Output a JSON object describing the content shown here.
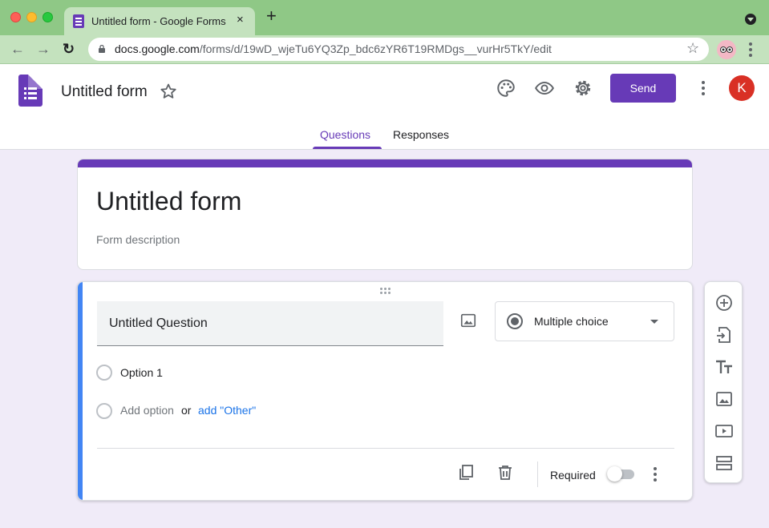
{
  "browser": {
    "tab_title": "Untitled form - Google Forms",
    "tab_close": "×",
    "new_tab": "+",
    "url_host": "docs.google.com",
    "url_path": "/forms/d/19wD_wjeTu6YQ3Zp_bdc6zYR6T19RMDgs__vurHr5TkY/edit",
    "back": "←",
    "forward": "→",
    "reload": "↻",
    "bookmark": "☆"
  },
  "header": {
    "doc_title": "Untitled form",
    "send_label": "Send",
    "avatar_letter": "K",
    "accent": "#673ab7"
  },
  "tabs": [
    {
      "label": "Questions",
      "active": true
    },
    {
      "label": "Responses",
      "active": false
    }
  ],
  "form": {
    "title": "Untitled form",
    "description": "Form description"
  },
  "question": {
    "text": "Untitled Question",
    "type": "Multiple choice",
    "options": [
      "Option 1"
    ],
    "add_option": "Add option",
    "or": "or",
    "add_other": "add \"Other\"",
    "required_label": "Required",
    "required": false
  },
  "side_toolbar": [
    "add-question-icon",
    "import-questions-icon",
    "add-title-icon",
    "add-image-icon",
    "add-video-icon",
    "add-section-icon"
  ]
}
